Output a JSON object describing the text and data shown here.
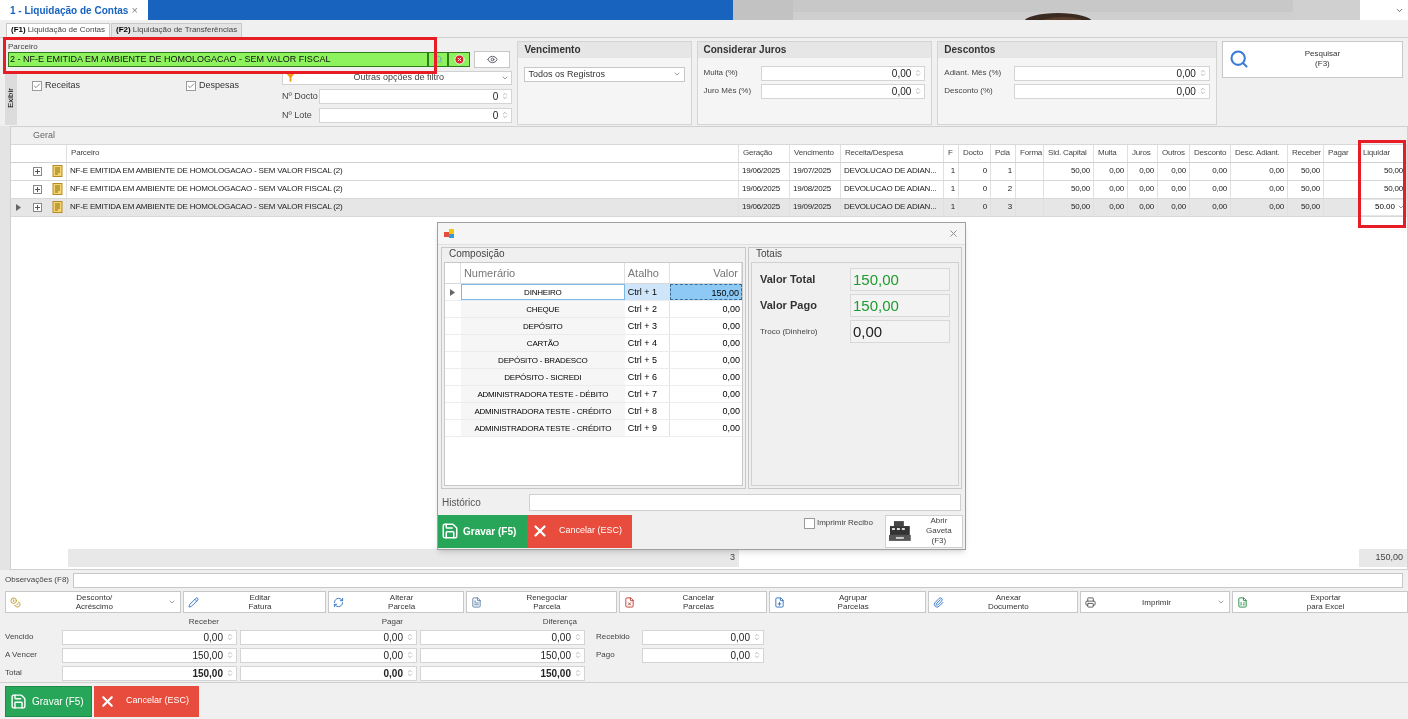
{
  "tabs": [
    {
      "label": "1 - Liquidação de Contas",
      "selected": true,
      "close": "×"
    }
  ],
  "sub_tabs": [
    {
      "key": "(F1)",
      "label": "Liquidação de Contas",
      "selected": true
    },
    {
      "key": "(F2)",
      "label": "Liquidação de Transferências",
      "selected": false
    }
  ],
  "filter": {
    "partner_label": "Parceiro",
    "partner_value": "2 - NF-E EMITIDA EM AMBIENTE DE HOMOLOGACAO - SEM VALOR FISCAL",
    "show_label": "Exibir",
    "checkboxes": [
      {
        "label": "Receitas",
        "checked": true
      },
      {
        "label": "Despesas",
        "checked": true
      }
    ],
    "more_filters": "Outras opções de filtro",
    "numbers": [
      {
        "label": "Nº Docto",
        "value": "0"
      },
      {
        "label": "Nº Lote",
        "value": "0"
      }
    ]
  },
  "due": {
    "title": "Vencimento",
    "value": "Todos os Registros"
  },
  "interest": {
    "title": "Considerar Juros",
    "fields": [
      {
        "label": "Multa (%)",
        "value": "0,00"
      },
      {
        "label": "Juro Mês (%)",
        "value": "0,00"
      }
    ]
  },
  "discounts": {
    "title": "Descontos",
    "fields": [
      {
        "label": "Adiant. Mês (%)",
        "value": "0,00"
      },
      {
        "label": "Desconto (%)",
        "value": "0,00"
      }
    ]
  },
  "search_button": {
    "label": "Pesquisar",
    "shortcut": "(F3)"
  },
  "grid": {
    "group": "Geral",
    "columns": [
      "Parceiro",
      "Geração",
      "Vencimento",
      "Receita/Despesa",
      "F",
      "Docto",
      "Pcla",
      "Forma",
      "Sld. Capital",
      "Multa",
      "Juros",
      "Outros",
      "Desconto",
      "Desc. Adiant.",
      "Receber",
      "Pagar",
      "Liquidar"
    ],
    "rows": [
      {
        "selected": false,
        "cells": [
          "NF-E EMITIDA EM AMBIENTE DE HOMOLOGACAO - SEM VALOR FISCAL (2)",
          "19/06/2025",
          "19/07/2025",
          "DEVOLUCAO DE ADIAN...",
          "1",
          "0",
          "1",
          null,
          "50,00",
          "0,00",
          "0,00",
          "0,00",
          "0,00",
          "0,00",
          "50,00",
          null,
          "50,00"
        ]
      },
      {
        "selected": false,
        "cells": [
          "NF-E EMITIDA EM AMBIENTE DE HOMOLOGACAO - SEM VALOR FISCAL (2)",
          "19/06/2025",
          "19/08/2025",
          "DEVOLUCAO DE ADIAN...",
          "1",
          "0",
          "2",
          null,
          "50,00",
          "0,00",
          "0,00",
          "0,00",
          "0,00",
          "0,00",
          "50,00",
          null,
          "50,00"
        ]
      },
      {
        "selected": true,
        "cells": [
          "NF-E EMITIDA EM AMBIENTE DE HOMOLOGACAO - SEM VALOR FISCAL (2)",
          "19/06/2025",
          "19/09/2025",
          "DEVOLUCAO DE ADIAN...",
          "1",
          "0",
          "3",
          null,
          "50,00",
          "0,00",
          "0,00",
          "0,00",
          "0,00",
          "0,00",
          "50,00",
          null,
          "50.00"
        ]
      }
    ],
    "footer": {
      "count": "3",
      "total": "150,00"
    }
  },
  "dialog": {
    "composition_title": "Composição",
    "columns": [
      "Numerário",
      "Atalho",
      "Valor"
    ],
    "rows": [
      {
        "name": "DINHEIRO",
        "shortcut": "Ctrl + 1",
        "value": "150,00",
        "selected": true
      },
      {
        "name": "CHEQUE",
        "shortcut": "Ctrl + 2",
        "value": "0,00",
        "selected": false
      },
      {
        "name": "DEPÓSITO",
        "shortcut": "Ctrl + 3",
        "value": "0,00",
        "selected": false
      },
      {
        "name": "CARTÃO",
        "shortcut": "Ctrl + 4",
        "value": "0,00",
        "selected": false
      },
      {
        "name": "DEPÓSITO - BRADESCO",
        "shortcut": "Ctrl + 5",
        "value": "0,00",
        "selected": false
      },
      {
        "name": "DEPÓSITO - SICREDI",
        "shortcut": "Ctrl + 6",
        "value": "0,00",
        "selected": false
      },
      {
        "name": "ADMINISTRADORA TESTE - DÉBITO",
        "shortcut": "Ctrl + 7",
        "value": "0,00",
        "selected": false
      },
      {
        "name": "ADMINISTRADORA TESTE - CRÉDITO",
        "shortcut": "Ctrl + 8",
        "value": "0,00",
        "selected": false
      },
      {
        "name": "ADMINISTRADORA TESTE - CRÉDITO",
        "shortcut": "Ctrl + 9",
        "value": "0,00",
        "selected": false
      }
    ],
    "totals_title": "Totais",
    "totals": [
      {
        "kind": "highlight",
        "label": "Valor Total",
        "value": "150,00"
      },
      {
        "kind": "highlight",
        "label": "Valor Pago",
        "value": "150,00"
      },
      {
        "kind": "plain",
        "label": "Troco (Dinheiro)",
        "value": "0,00"
      }
    ],
    "history_label": "Histórico",
    "save": "Gravar (F5)",
    "cancel": "Cancelar (ESC)",
    "print_receipt": {
      "label": "Imprimir Recibo",
      "checked": false
    },
    "drawer": [
      "Abrir",
      "Gaveta (F3)"
    ]
  },
  "notes": {
    "label": "Observações (F8)"
  },
  "toolbar": [
    {
      "lines": [
        "Desconto/",
        "Acréscimo"
      ],
      "dropdown": true
    },
    {
      "lines": [
        "Editar",
        "Fatura"
      ],
      "dropdown": false
    },
    {
      "lines": [
        "Alterar",
        "Parcela"
      ],
      "dropdown": false
    },
    {
      "lines": [
        "Renegociar",
        "Parcela"
      ],
      "dropdown": false
    },
    {
      "lines": [
        "Cancelar",
        "Parcelas"
      ],
      "dropdown": false
    },
    {
      "lines": [
        "Agrupar",
        "Parcelas"
      ],
      "dropdown": false
    },
    {
      "lines": [
        "Anexar",
        "Documento"
      ],
      "dropdown": false
    },
    {
      "lines": [
        "Imprimir"
      ],
      "dropdown": true
    },
    {
      "lines": [
        "Exportar",
        "para Excel"
      ],
      "dropdown": false
    }
  ],
  "summary": {
    "columns": [
      "Receber",
      "Pagar",
      "Diferença"
    ],
    "rows": [
      {
        "kind": "detail",
        "label": "Vencido",
        "values": [
          "0,00",
          "0,00",
          "0,00"
        ],
        "side": {
          "label": "Recebido",
          "value": "0,00"
        }
      },
      {
        "kind": "detail",
        "label": "A Vencer",
        "values": [
          "150,00",
          "0,00",
          "150,00"
        ],
        "side": {
          "label": "Pago",
          "value": "0,00"
        }
      },
      {
        "kind": "total",
        "label": "Total",
        "values": [
          "150,00",
          "0,00",
          "150,00"
        ]
      }
    ]
  },
  "actions": {
    "save": "Gravar (F5)",
    "cancel": "Cancelar (ESC)"
  }
}
